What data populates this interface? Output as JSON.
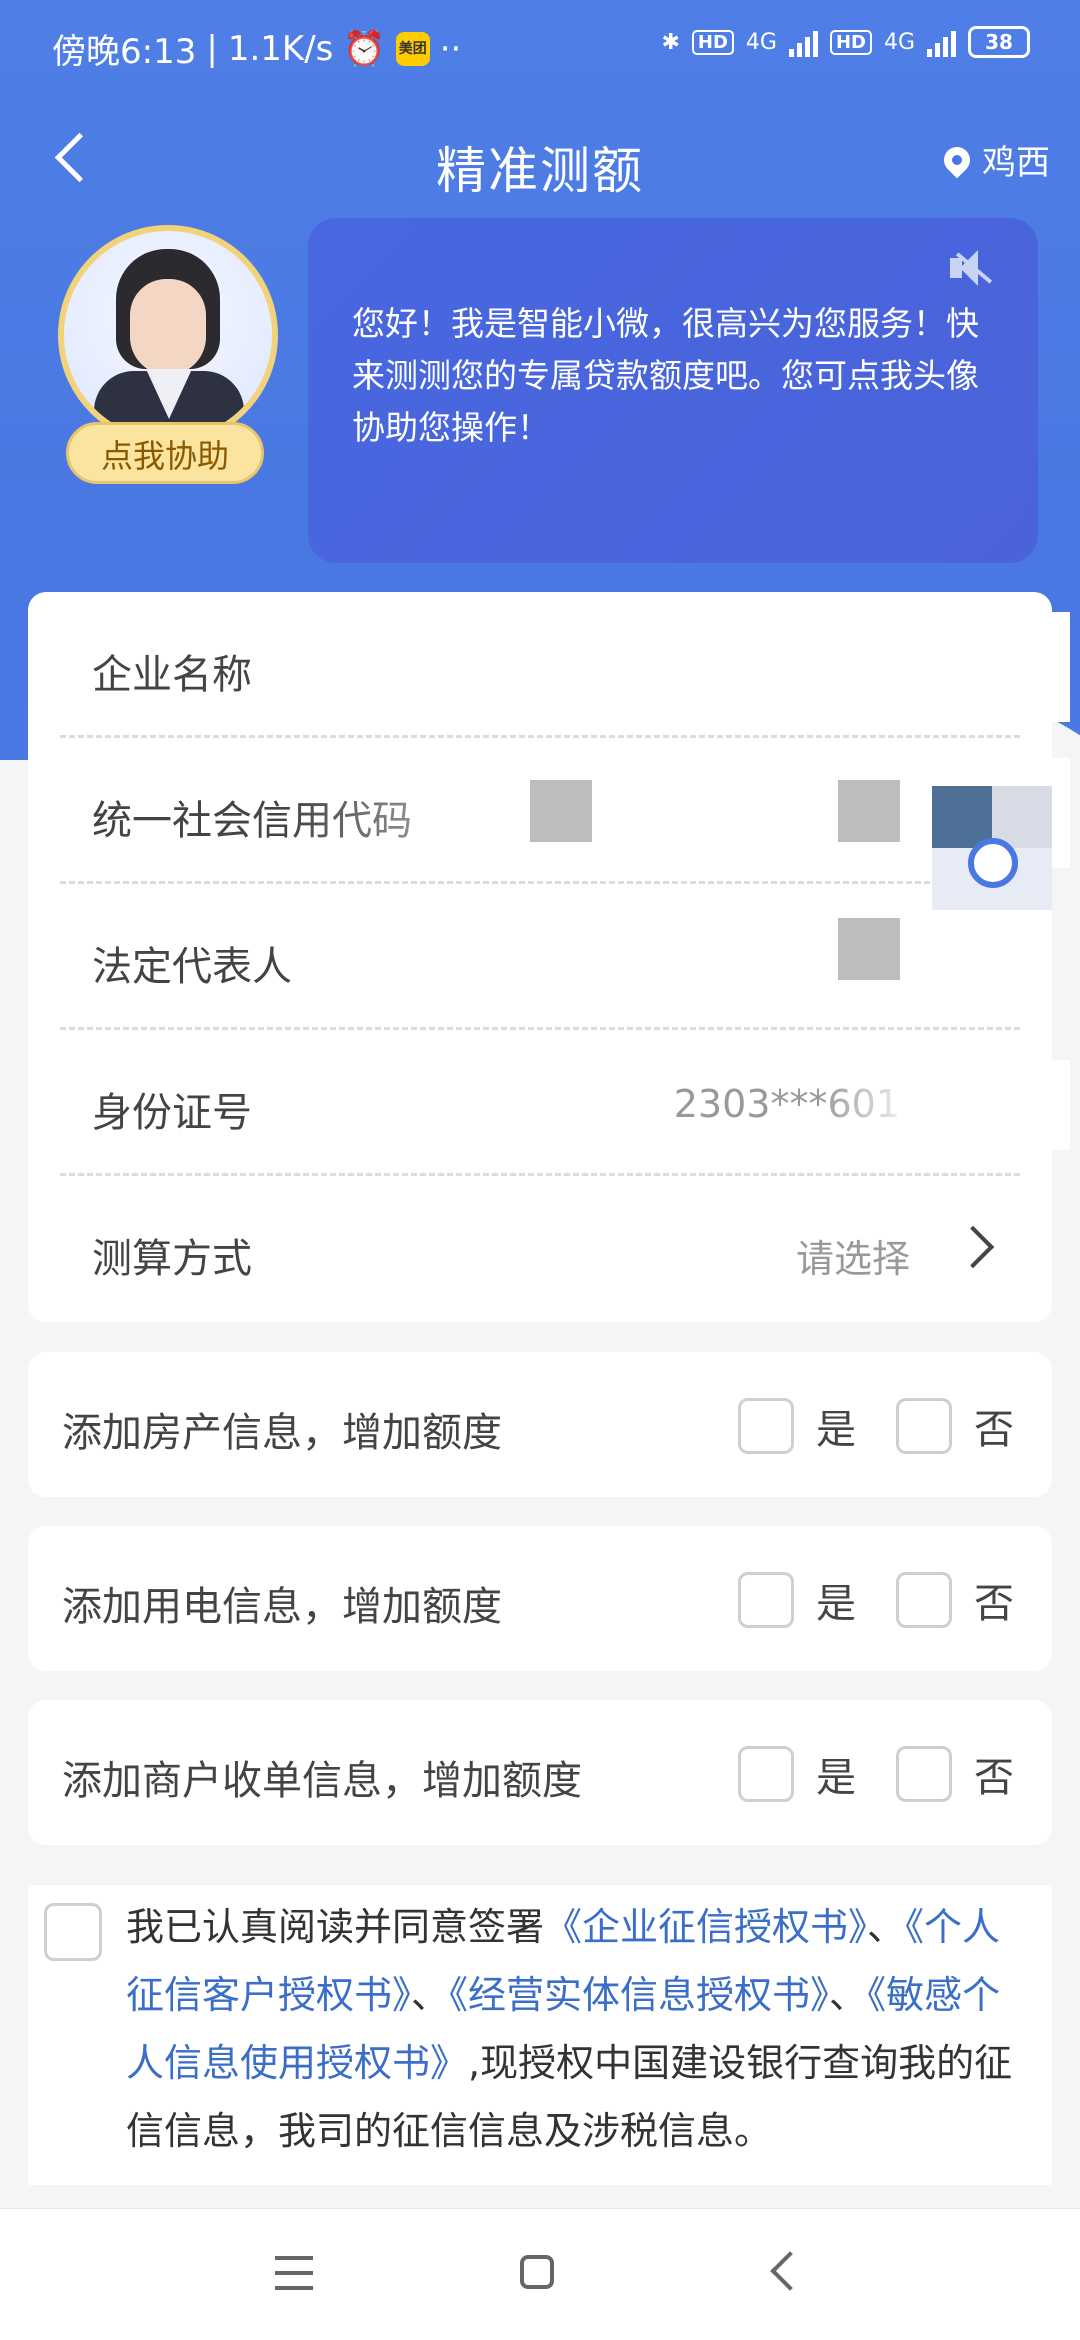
{
  "status_bar": {
    "time": "傍晚6:13",
    "speed": "1.1K/s",
    "app_badge": "美团",
    "dots": "··",
    "hd1": "HD",
    "net1": "4G",
    "hd2": "HD",
    "net2": "4G",
    "battery": "38"
  },
  "nav": {
    "title": "精准测额",
    "location": "鸡西"
  },
  "assistant": {
    "button_label": "点我协助",
    "greeting": "您好！我是智能小微，很高兴为您服务！快来测测您的专属贷款额度吧。您可点我头像协助您操作！"
  },
  "form": {
    "company_name_label": "企业名称",
    "credit_code_label": "统一社会信用代码",
    "legal_rep_label": "法定代表人",
    "id_label": "身份证号",
    "id_value": "2303***601",
    "method_label": "测算方式",
    "method_placeholder": "请选择"
  },
  "options": {
    "yes": "是",
    "no": "否",
    "property_label": "添加房产信息，增加额度",
    "electricity_label": "添加用电信息，增加额度",
    "merchant_label": "添加商户收单信息，增加额度"
  },
  "agreement": {
    "prefix": "我已认真阅读并同意签署",
    "doc1": "《企业征信授权书》",
    "sep1": "、",
    "doc2": "《个人征信客户授权书》",
    "sep2": "、",
    "doc3": "《经营实体信息授权书》",
    "sep3": "、",
    "doc4": "《敏感个人信息使用授权书》",
    "suffix": ",现授权中国建设银行查询我的征信信息，我司的征信信息及涉税信息。"
  },
  "colors": {
    "brand_blue": "#4a78e2",
    "link_blue": "#3a6ec8",
    "assist_yellow": "#fbe3a0"
  }
}
